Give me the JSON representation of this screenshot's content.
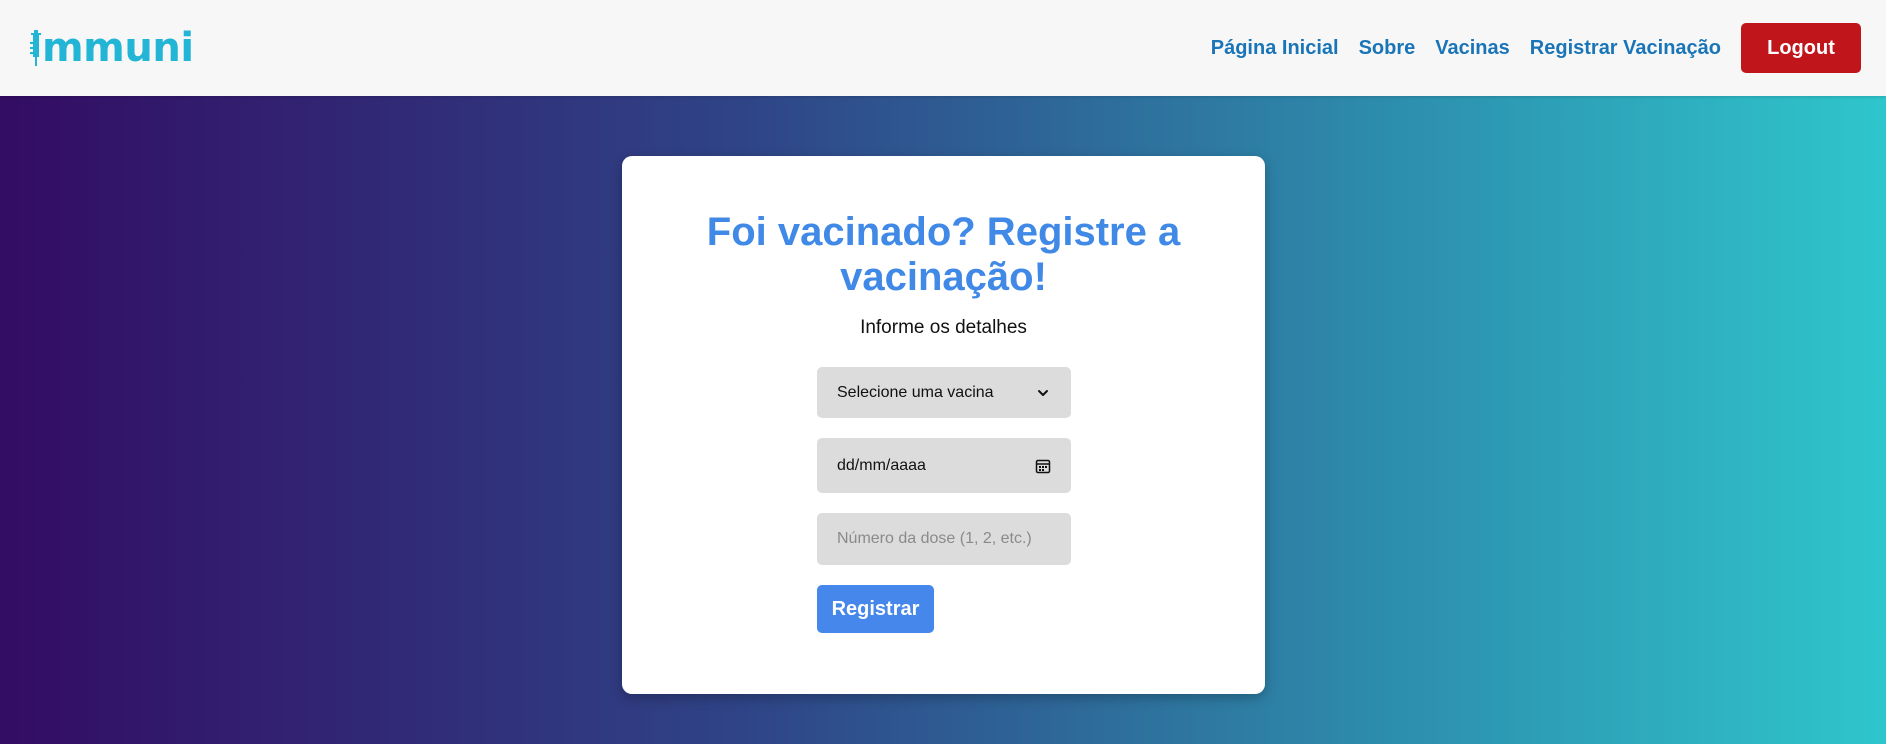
{
  "brand": {
    "logo_text": "mmuni",
    "logo_alt": "Immuni"
  },
  "nav": {
    "items": [
      {
        "label": "Página Inicial"
      },
      {
        "label": "Sobre"
      },
      {
        "label": "Vacinas"
      },
      {
        "label": "Registrar Vacinação"
      }
    ],
    "logout_label": "Logout"
  },
  "form": {
    "title": "Foi vacinado? Registre a vacinação!",
    "subtitle": "Informe os detalhes",
    "vaccine_select": {
      "selected": "Selecione uma vacina"
    },
    "date_input": {
      "placeholder": "dd/mm/aaaa"
    },
    "dose_input": {
      "placeholder": "Número da dose (1, 2, etc.)"
    },
    "submit_label": "Registrar"
  },
  "colors": {
    "accent": "#4089e6",
    "nav_link": "#1a75b8",
    "logout": "#c0151b",
    "submit": "#4587ea",
    "gradient_start": "#330c63",
    "gradient_end": "#2ec6cc"
  },
  "icons": {
    "logo": "syringe-icon",
    "select": "chevron-down-icon",
    "date": "calendar-icon"
  }
}
